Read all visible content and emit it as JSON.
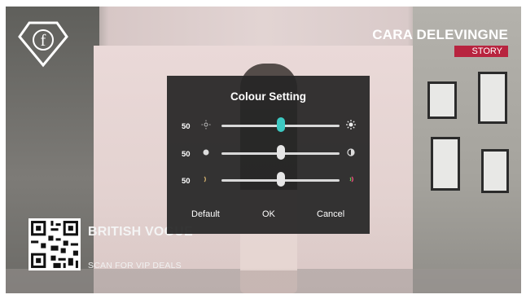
{
  "brand": {
    "name": "CARA DELEVINGNE",
    "tag": "STORY"
  },
  "logo": {
    "letter": "f"
  },
  "promo": {
    "title": "BRITISH VOGUE",
    "subtitle": "SCAN FOR VIP DEALS"
  },
  "dialog": {
    "title": "Colour Setting",
    "sliders": [
      {
        "value": "50",
        "level": 0.5,
        "left_icon": "brightness-low-icon",
        "right_icon": "brightness-high-icon",
        "thumb_color": "#3cc9c2"
      },
      {
        "value": "50",
        "level": 0.5,
        "left_icon": "contrast-dot-icon",
        "right_icon": "contrast-half-icon",
        "thumb_color": "#e6e6e6"
      },
      {
        "value": "50",
        "level": 0.5,
        "left_icon": "color-low-icon",
        "right_icon": "color-high-icon",
        "thumb_color": "#e6e6e6"
      }
    ],
    "buttons": {
      "default": "Default",
      "ok": "OK",
      "cancel": "Cancel"
    }
  },
  "colors": {
    "accent_teal": "#3cc9c2",
    "brand_red": "#b8243f"
  }
}
